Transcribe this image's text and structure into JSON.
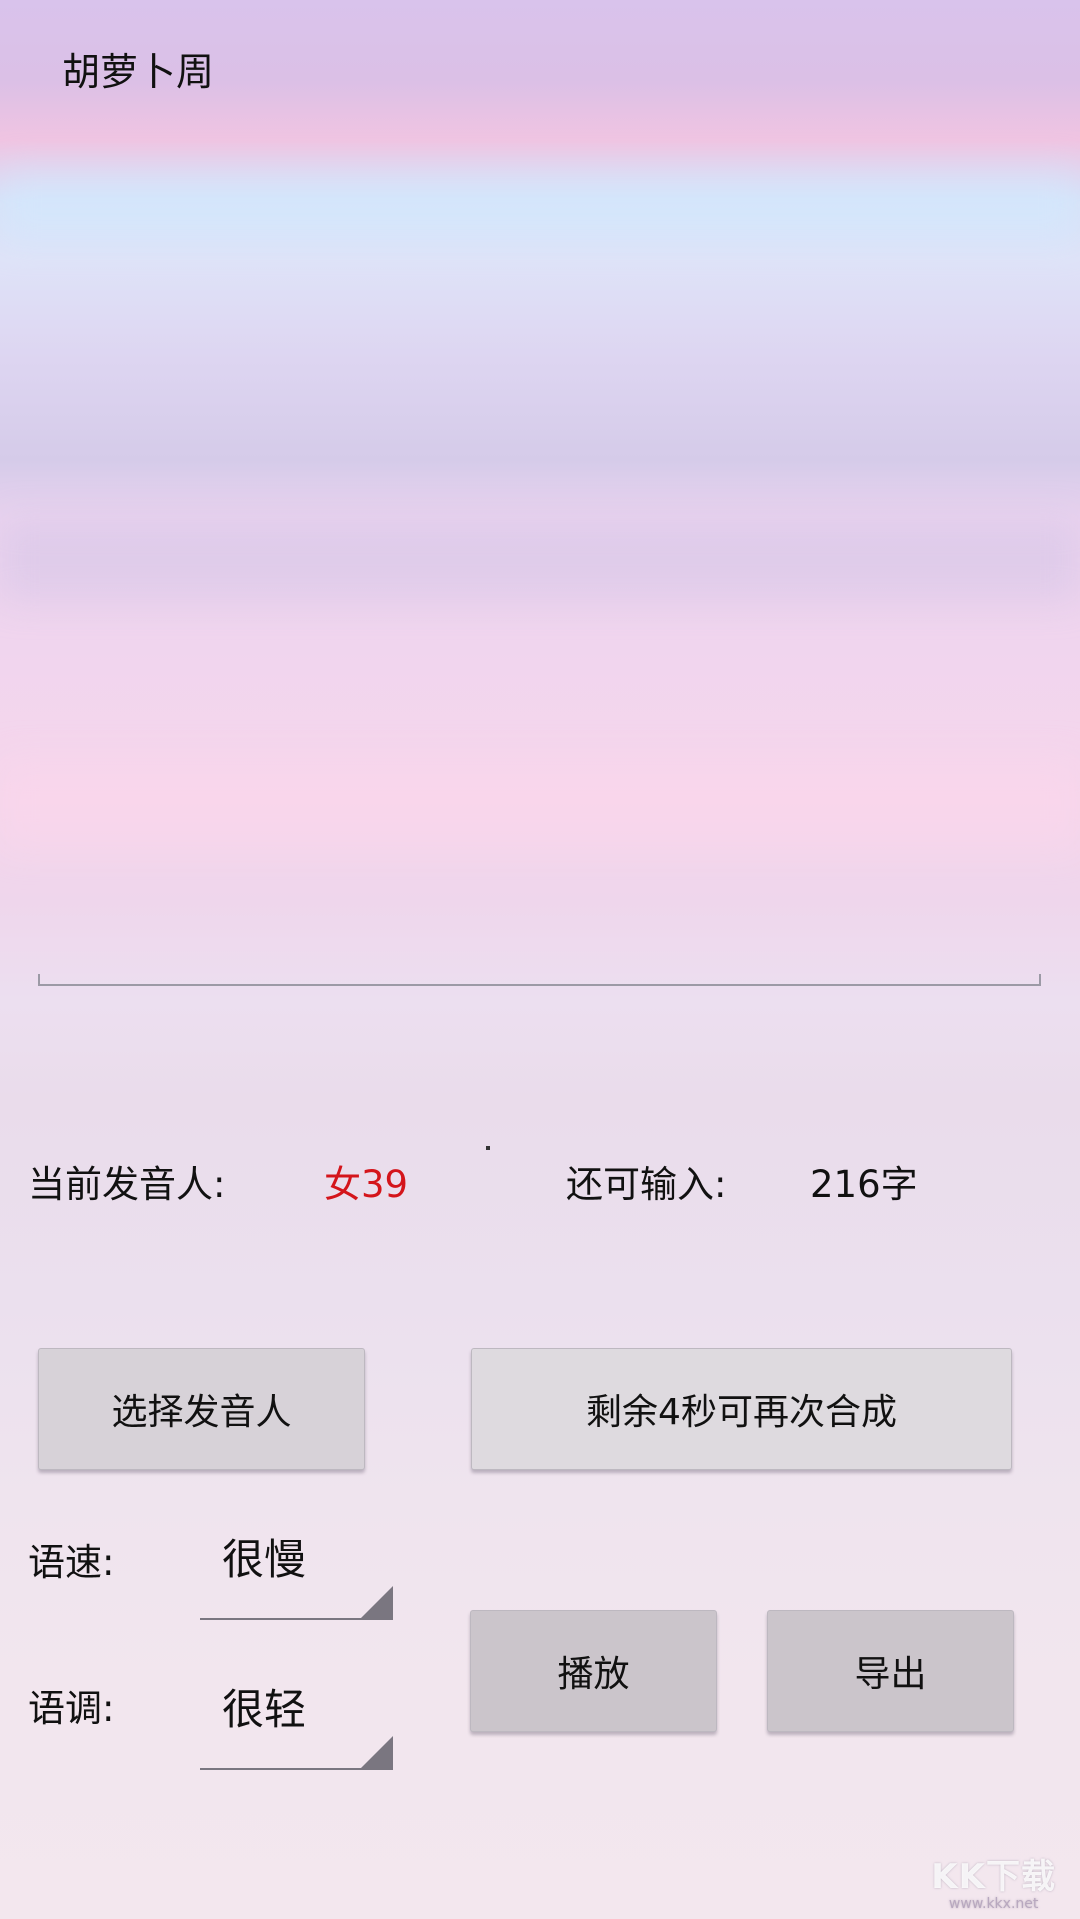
{
  "header": {
    "title": "胡萝卜周"
  },
  "editor": {
    "text": ""
  },
  "info": {
    "speaker_label": "当前发音人:",
    "speaker_value": "女39",
    "remaining_label": "还可输入:",
    "remaining_value": "216字",
    "speaker_value_color": "#d4151b"
  },
  "buttons": {
    "choose_speaker": "选择发音人",
    "synthesize": "剩余4秒可再次合成",
    "play": "播放",
    "export": "导出"
  },
  "settings": {
    "speed_label": "语速:",
    "speed_value": "很慢",
    "tone_label": "语调:",
    "tone_value": "很轻"
  },
  "watermark": {
    "logo": "KK下载",
    "url": "www.kkx.net"
  }
}
